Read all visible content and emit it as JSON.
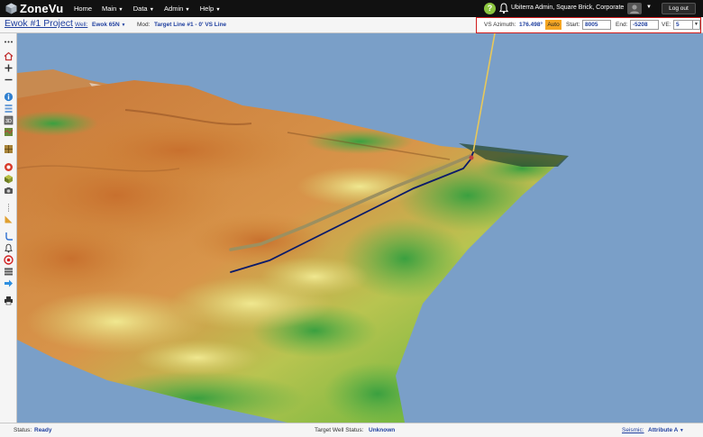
{
  "app": {
    "name": "ZoneVu"
  },
  "nav": [
    {
      "label": "Home",
      "has_menu": false
    },
    {
      "label": "Main",
      "has_menu": true
    },
    {
      "label": "Data",
      "has_menu": true
    },
    {
      "label": "Admin",
      "has_menu": true
    },
    {
      "label": "Help",
      "has_menu": true
    }
  ],
  "user": {
    "name": "Ubiterra Admin, Square Brick, Corporate",
    "logout_label": "Log out"
  },
  "project": {
    "title": "Ewok #1 Project"
  },
  "well": {
    "label": "Well:",
    "value": "Ewok 65N"
  },
  "mod": {
    "label": "Mod:",
    "value": "Target Line #1 - 0' VS Line"
  },
  "vs": {
    "azimuth_label": "VS Azimuth:",
    "azimuth_value": "176.498°",
    "auto_label": "Auto",
    "start_label": "Start:",
    "start_value": "8005",
    "end_label": "End:",
    "end_value": "-5208",
    "ve_label": "VE:",
    "ve_value": "5"
  },
  "status": {
    "label": "Status:",
    "value": "Ready",
    "target_label": "Target Well Status:",
    "target_value": "Unknown",
    "seismic_label": "Seismic:",
    "seismic_value": "Attribute A"
  },
  "sidebar_tools": [
    "more-icon",
    "home-icon",
    "zoom-in-icon",
    "zoom-out-icon",
    "info-icon",
    "layers-icon",
    "3d-box-icon",
    "map-icon",
    "grid-icon",
    "target-icon",
    "cube-icon",
    "camera-icon",
    "ruler-icon",
    "measure-icon",
    "well-path-icon",
    "alert-icon",
    "stop-icon",
    "stack-icon",
    "arrow-right-icon",
    "print-icon"
  ],
  "colors": {
    "topbar": "#111111",
    "link": "#1f3f9f",
    "highlight_border": "#d01c1c",
    "auto_button": "#f5a623",
    "sky": "#7a9fc8",
    "well_path_navy": "#0a1a6a",
    "well_path_tan": "#9c9060",
    "well_vertical": "#e8c85a"
  }
}
